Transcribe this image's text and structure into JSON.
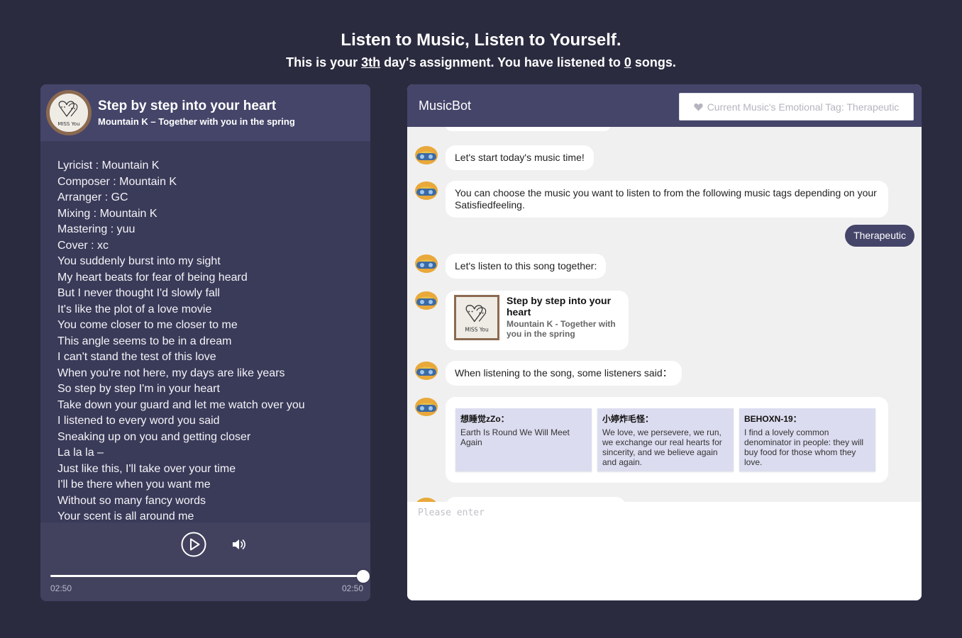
{
  "header": {
    "title": "Listen to Music, Listen to Yourself.",
    "sub_prefix": "This is your ",
    "day": "3th",
    "sub_middle": " day's assignment. You have listened to ",
    "songs_count": "0",
    "sub_suffix": " songs."
  },
  "player": {
    "title": "Step by step into your heart",
    "artist": "Mountain K – Together with you in the spring",
    "cover_icon": "heart-doodle-icon",
    "cover_text": "MISS You",
    "lyrics": [
      "Lyricist : Mountain K",
      "Composer : Mountain K",
      "Arranger : GC",
      "Mixing : Mountain K",
      "Mastering : yuu",
      "Cover : xc",
      "You suddenly burst into my sight",
      "My heart beats for fear of being heard",
      "But I never thought I'd slowly fall",
      "It's like the plot of a love movie",
      "You come closer to me closer to me",
      "This angle seems to be in a dream",
      "I can't stand the test of this love",
      "When you're not here, my days are like years",
      "So step by step I'm in your heart",
      "Take down your guard and let me watch over you",
      "I listened to every word you said",
      "Sneaking up on you and getting closer",
      "La la la –",
      "Just like this, I'll take over your time",
      "I'll be there when you want me",
      "Without so many fancy words",
      "Your scent is all around me"
    ],
    "current_time": "02:50",
    "total_time": "02:50",
    "progress": 1.0
  },
  "chat": {
    "title": "MusicBot",
    "tag_label": "Current Music's Emotional Tag: Therapeutic",
    "messages": {
      "m1": "Let's start today's music time!",
      "m2": "You can choose the music you want to listen to from the following music tags depending on your Satisfiedfeeling.",
      "user_reply": "Therapeutic",
      "m3": "Let's listen to this song together:",
      "card_title": "Step by step into your heart",
      "card_artist": "Mountain K - Together with you in the spring",
      "m4": "When listening to the song, some listeners said："
    },
    "comments": [
      {
        "user": "想睡觉zZo：",
        "text": "Earth Is Round We Will Meet Again"
      },
      {
        "user": "小婷炸毛怪：",
        "text": "We love, we persevere, we run, we exchange our real hearts for sincerity, and we believe again and again."
      },
      {
        "user": "BEHOXN-19：",
        "text": "I find a lovely common denominator in people: they will buy food for those whom they love."
      }
    ],
    "input_placeholder": "Please enter"
  },
  "colors": {
    "background": "#2b2b40",
    "panel_header": "#45456a",
    "accent": "#45456a"
  }
}
